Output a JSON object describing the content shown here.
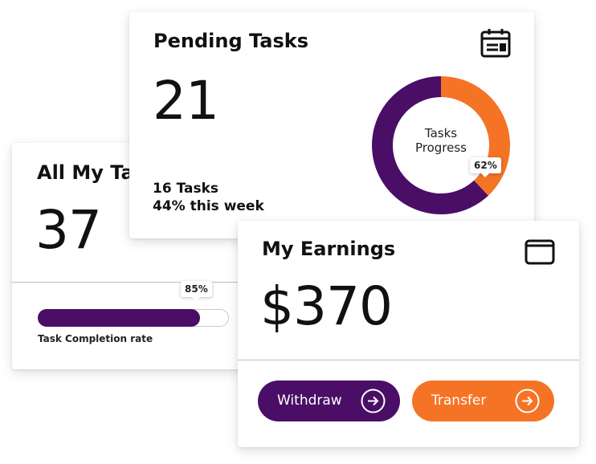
{
  "colors": {
    "primary": "#4a0e66",
    "accent": "#f57325",
    "track": "#c8c8c8"
  },
  "tasks_card": {
    "title": "All My Tasks",
    "count": "37",
    "completion_rate_label": "Task Completion rate",
    "completion_percent_text": "85%",
    "completion_fraction": 0.85
  },
  "pending_card": {
    "title": "Pending Tasks",
    "count": "21",
    "sub_tasks": "16 Tasks",
    "sub_week": "44% this week",
    "icon": "calendar-icon",
    "donut": {
      "center_line1": "Tasks",
      "center_line2": "Progress",
      "percent_text": "62%",
      "segments": [
        {
          "name": "",
          "value": 38,
          "color": "#f57325"
        },
        {
          "name": "",
          "value": 62,
          "color": "#4a0e66"
        }
      ]
    }
  },
  "earnings_card": {
    "title": "My Earnings",
    "amount": "$370",
    "icon": "wallet-icon",
    "withdraw_label": "Withdraw",
    "transfer_label": "Transfer"
  }
}
